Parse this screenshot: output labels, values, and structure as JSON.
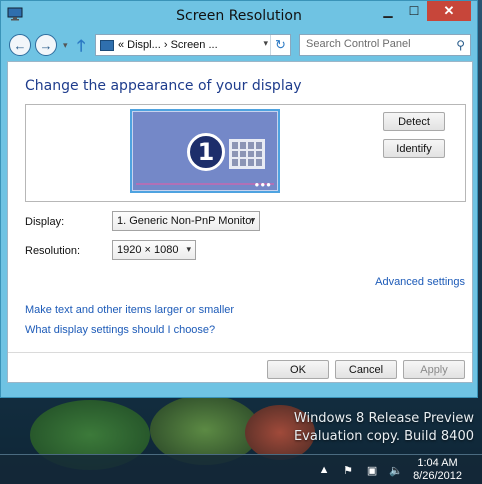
{
  "window": {
    "title": "Screen Resolution"
  },
  "nav": {
    "address": "« Displ... › Screen ...",
    "search_placeholder": "Search Control Panel"
  },
  "content": {
    "heading": "Change the appearance of your display",
    "monitor_number": "1",
    "detect_label": "Detect",
    "identify_label": "Identify",
    "display_label": "Display:",
    "display_value": "1. Generic Non-PnP Monitor",
    "resolution_label": "Resolution:",
    "resolution_value": "1920 × 1080",
    "advanced_link": "Advanced settings",
    "link_larger": "Make text and other items larger or smaller",
    "link_help": "What display settings should I choose?",
    "ok_label": "OK",
    "cancel_label": "Cancel",
    "apply_label": "Apply"
  },
  "desktop": {
    "watermark_line1": "Windows 8 Release Preview",
    "watermark_line2": "Evaluation copy. Build 8400"
  },
  "taskbar": {
    "time": "1:04 AM",
    "date": "8/26/2012"
  },
  "colors": {
    "accent": "#6fc3e3",
    "heading": "#1e3c8c",
    "link": "#1d5bb8",
    "close": "#c7463a"
  }
}
